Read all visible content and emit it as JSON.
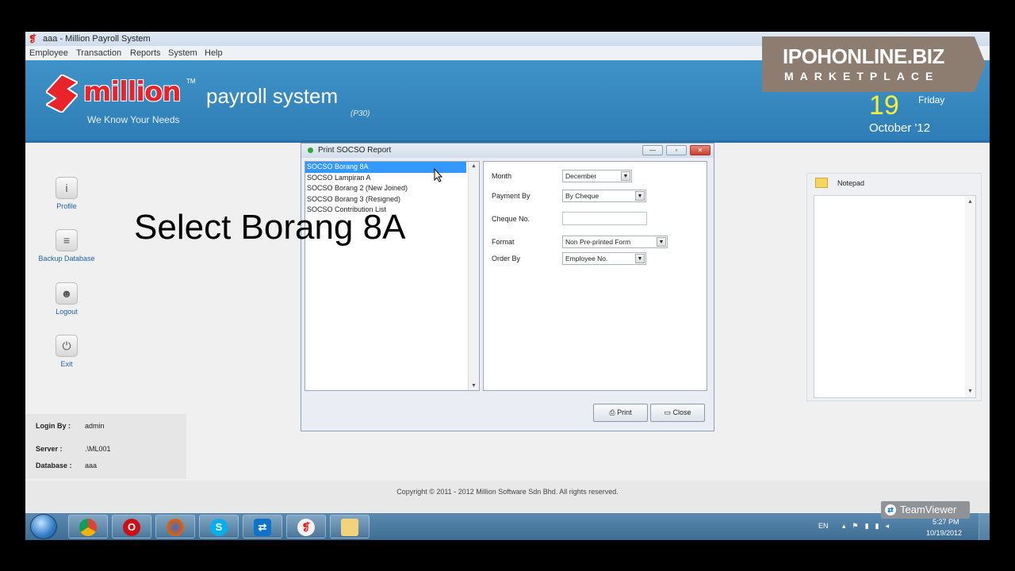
{
  "window": {
    "title": "aaa - Million Payroll System"
  },
  "menu": [
    "Employee",
    "Transaction",
    "Reports",
    "System",
    "Help"
  ],
  "header": {
    "logo_text": "million",
    "logo_tm": "TM",
    "tagline": "We Know Your Needs",
    "product": "payroll system",
    "version": "(P30)",
    "date_day": "19",
    "date_weekday": "Friday",
    "date_month": "October '12"
  },
  "watermark": {
    "line1": "IPOHONLINE.BIZ",
    "line2": "MARKETPLACE"
  },
  "sidebar": {
    "items": [
      {
        "label": "Profile",
        "icon": "info-icon"
      },
      {
        "label": "Backup Database",
        "icon": "database-icon"
      },
      {
        "label": "Logout",
        "icon": "user-icon"
      },
      {
        "label": "Exit",
        "icon": "power-icon"
      }
    ]
  },
  "login": {
    "login_by_label": "Login By :",
    "login_by": "admin",
    "server_label": "Server :",
    "server": ".\\ML001",
    "database_label": "Database :",
    "database": "aaa"
  },
  "caption": "Select Borang 8A",
  "dialog": {
    "title": "Print SOCSO Report",
    "reports": [
      "SOCSO Borang 8A",
      "SOCSO Lampiran A",
      "SOCSO Borang 2 (New Joined)",
      "SOCSO Borang 3 (Resigned)",
      "SOCSO Contribution List"
    ],
    "selected_index": 0,
    "params": {
      "month_label": "Month",
      "month": "December",
      "payment_label": "Payment By",
      "payment": "By Cheque",
      "cheque_label": "Cheque No.",
      "cheque": "",
      "format_label": "Format",
      "format": "Non Pre-printed Form",
      "order_label": "Order By",
      "order": "Employee No."
    },
    "print_label": "Print",
    "close_label": "Close"
  },
  "notepad": {
    "title": "Notepad"
  },
  "footer": {
    "copyright": "Copyright © 2011 - 2012 Million Software Sdn Bhd. All rights reserved."
  },
  "taskbar": {
    "apps": [
      "chrome-icon",
      "opera-icon",
      "firefox-icon",
      "skype-icon",
      "teamviewer-icon",
      "million-icon",
      "folder-icon"
    ],
    "lang": "EN",
    "time": "5:27 PM",
    "date": "10/19/2012"
  },
  "teamviewer_badge": "TeamViewer",
  "colors": {
    "banner": "#3f93c9",
    "logo_red": "#e8232a",
    "date_yellow": "#f4f03a",
    "selection": "#3399ff"
  }
}
